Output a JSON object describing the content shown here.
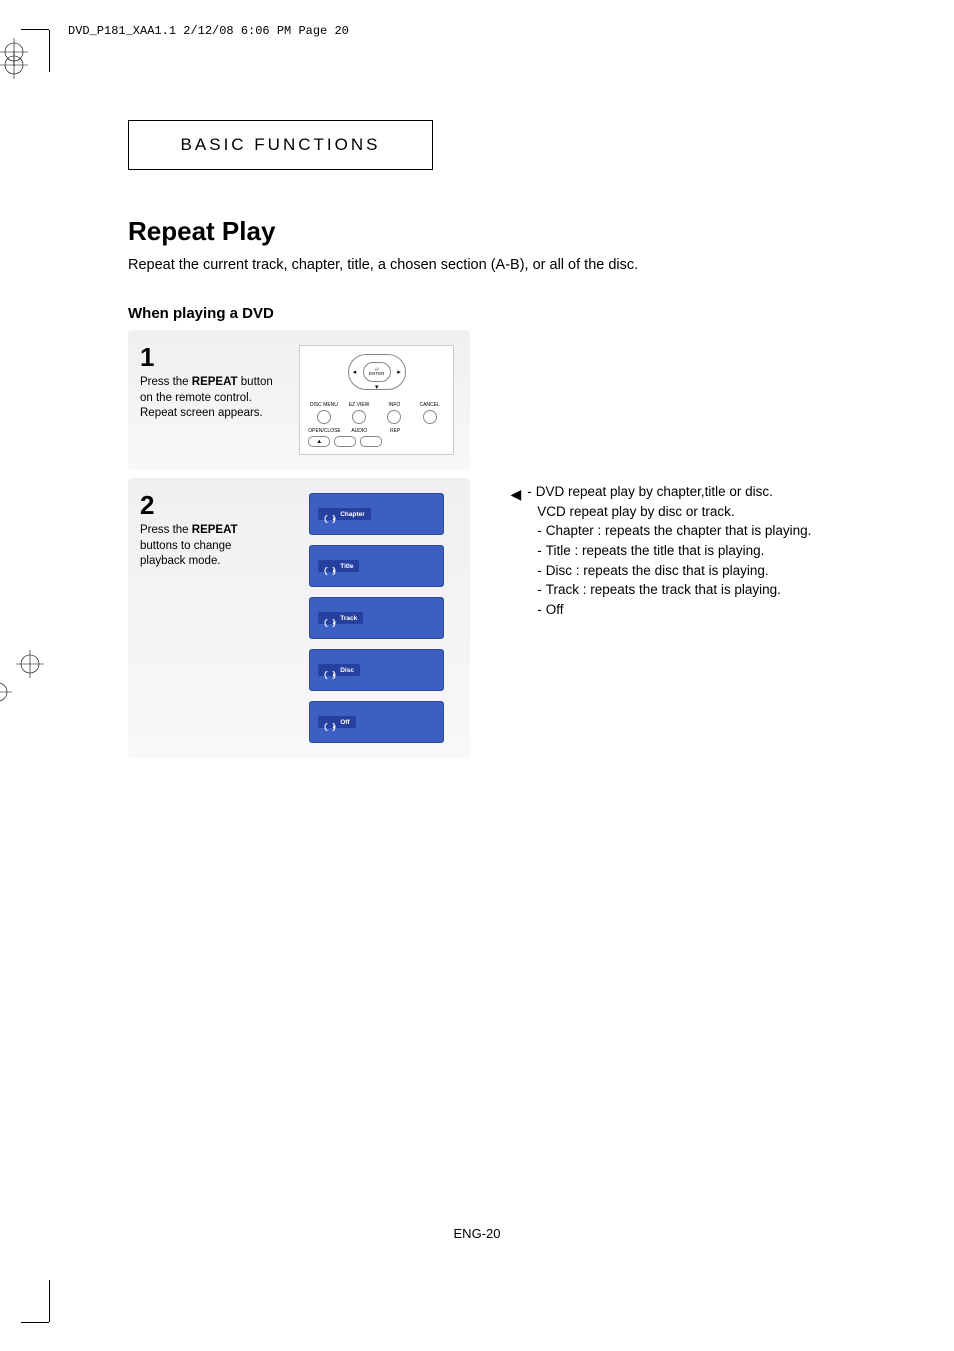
{
  "header": "DVD_P181_XAA1.1  2/12/08  6:06 PM  Page 20",
  "tab": "BASIC FUNCTIONS",
  "title": "Repeat Play",
  "subtitle": "Repeat the current track, chapter, title, a chosen section (A-B), or all of the disc.",
  "sectionLabel": "When playing a DVD",
  "steps": [
    {
      "num": "1",
      "desc_prefix": "Press the ",
      "desc_bold": "REPEAT",
      "desc_suffix": " button on the remote control. Repeat screen appears."
    },
    {
      "num": "2",
      "desc_prefix": "Press the ",
      "desc_bold": "REPEAT",
      "desc_suffix": " buttons to change playback mode."
    }
  ],
  "remote": {
    "enter": "ENTER",
    "labels1": [
      "DISC MENU",
      "EZ VIEW",
      "INFO",
      "CANCEL"
    ],
    "labels2": [
      "OPEN/CLOSE",
      "AUDIO",
      "REP"
    ],
    "eject": "▲"
  },
  "osd": [
    "Chapter",
    "Title",
    "Track",
    "Disc",
    "Off"
  ],
  "info": {
    "line1": "DVD repeat play by chapter,title or disc.",
    "line2": "VCD repeat play by disc or track.",
    "items": [
      "Chapter : repeats the chapter that is playing.",
      "Title : repeats the title that is playing.",
      "Disc : repeats the disc that is playing.",
      "Track : repeats the track that is playing.",
      "Off"
    ]
  },
  "pageNum": "ENG-20"
}
